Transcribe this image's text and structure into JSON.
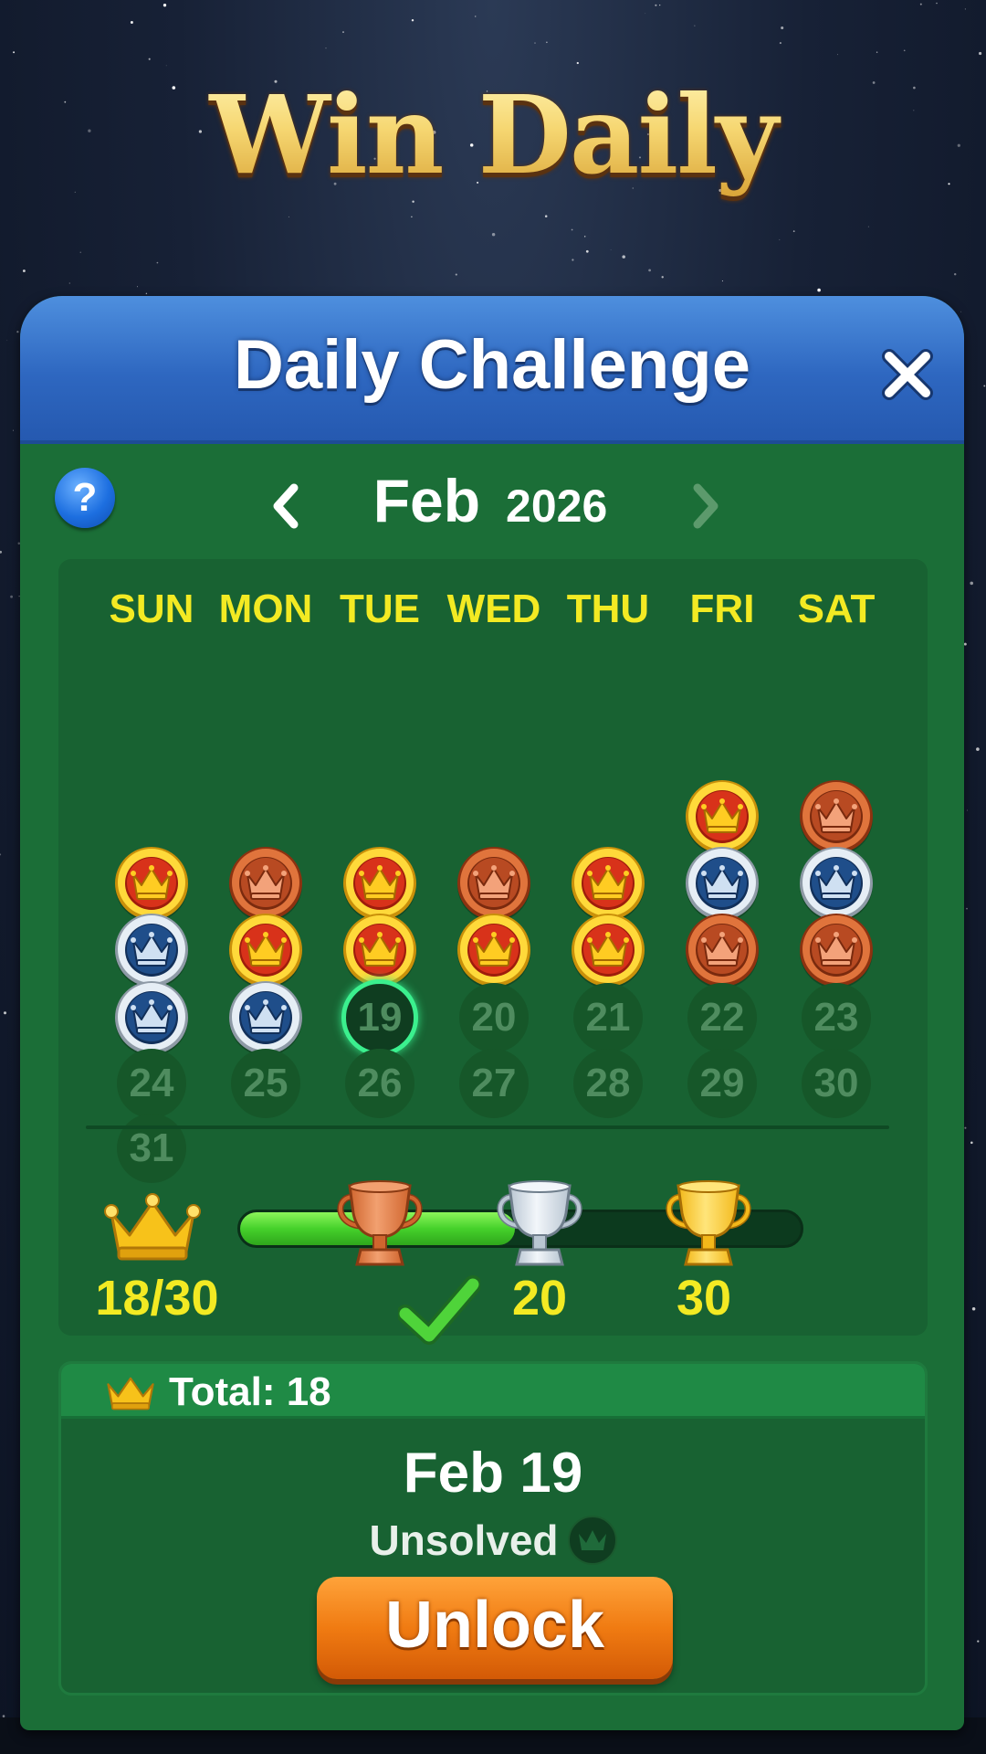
{
  "hero": {
    "title": "Win Daily"
  },
  "header": {
    "title": "Daily Challenge",
    "close_icon": "close-icon"
  },
  "month_nav": {
    "month": "Feb",
    "year": "2026",
    "help_label": "?",
    "prev_icon": "chevron-left-icon",
    "next_icon": "chevron-right-icon"
  },
  "calendar": {
    "weekdays": [
      "SUN",
      "MON",
      "TUE",
      "WED",
      "THU",
      "FRI",
      "SAT"
    ],
    "first_weekday_index": 5,
    "days_in_month": 31,
    "today": 19,
    "solved": {
      "1": "gold",
      "2": "bronze",
      "3": "gold",
      "4": "bronze",
      "5": "gold",
      "6": "bronze",
      "7": "gold",
      "8": "silver",
      "9": "silver",
      "10": "silver",
      "11": "gold",
      "12": "gold",
      "13": "gold",
      "14": "gold",
      "15": "bronze",
      "16": "bronze",
      "17": "silver",
      "18": "silver"
    },
    "medal_colors": {
      "gold": "#f2b90c",
      "bronze": "#c8562a",
      "silver": "#c7d3de"
    }
  },
  "progress": {
    "score_label": "18/30",
    "current": 18,
    "max": 30,
    "milestones": [
      {
        "value": 10,
        "trophy": "bronze",
        "label": "",
        "completed": true
      },
      {
        "value": 20,
        "trophy": "silver",
        "label": "20",
        "completed": false
      },
      {
        "value": 30,
        "trophy": "gold",
        "label": "30",
        "completed": false
      }
    ]
  },
  "detail": {
    "total_label": "Total: 18",
    "date": "Feb 19",
    "status": "Unsolved",
    "unlock_label": "Unlock"
  }
}
